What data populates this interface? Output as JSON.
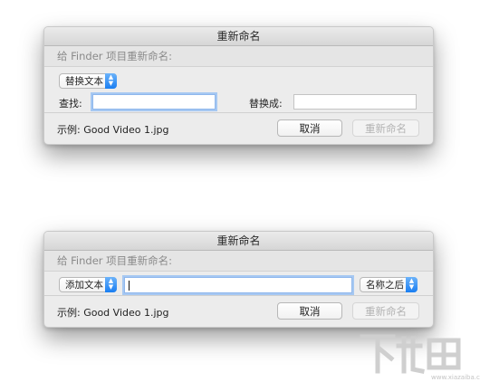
{
  "dialog_top": {
    "title": "重新命名",
    "header": "给 Finder 项目重新命名:",
    "mode_popup": "替换文本",
    "find_label": "查找:",
    "find_value": "",
    "replace_label": "替换成:",
    "replace_value": "",
    "example": "示例:  Good Video 1.jpg",
    "cancel_label": "取消",
    "rename_label": "重新命名"
  },
  "dialog_bottom": {
    "title": "重新命名",
    "header": "给 Finder 项目重新命名:",
    "mode_popup": "添加文本",
    "text_value": "",
    "position_popup": "名称之后",
    "example": "示例:  Good Video 1.jpg",
    "cancel_label": "取消",
    "rename_label": "重新命名"
  },
  "watermark": {
    "main": "下载吧",
    "sub": "www.xiazaiba.com"
  },
  "colors": {
    "accent": "#1a7ef2",
    "focus_ring": "#a6c8f2",
    "dialog_bg": "#ececec"
  }
}
